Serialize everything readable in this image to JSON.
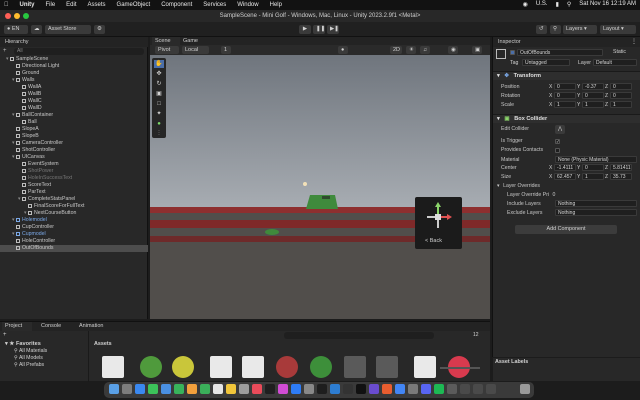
{
  "menubar": {
    "apple": "",
    "app": "Unity",
    "items": [
      "File",
      "Edit",
      "Assets",
      "GameObject",
      "Component",
      "Services",
      "Window",
      "Help"
    ],
    "right": {
      "input": "U.S.",
      "datetime": "Sat Nov 16  12:19 AM"
    }
  },
  "window": {
    "title": "SampleScene - Mini Golf - Windows, Mac, Linux - Unity 2023.2.9f1 <Metal>"
  },
  "toolbar": {
    "account": "EN",
    "asset_store": "Asset Store",
    "layers": "Layers",
    "layout": "Layout"
  },
  "hierarchy": {
    "tab": "Hierarchy",
    "search_placeholder": "All",
    "rows": [
      {
        "label": "SampleScene",
        "indent": 0,
        "kind": "scene"
      },
      {
        "label": "Directional Light",
        "indent": 1
      },
      {
        "label": "Ground",
        "indent": 1
      },
      {
        "label": "Walls",
        "indent": 1,
        "arrow": true
      },
      {
        "label": "WallA",
        "indent": 2
      },
      {
        "label": "WallB",
        "indent": 2
      },
      {
        "label": "WallC",
        "indent": 2
      },
      {
        "label": "WallD",
        "indent": 2
      },
      {
        "label": "BallContainer",
        "indent": 1,
        "arrow": true
      },
      {
        "label": "Ball",
        "indent": 2
      },
      {
        "label": "SlopeA",
        "indent": 1
      },
      {
        "label": "SlopeB",
        "indent": 1
      },
      {
        "label": "CameraController",
        "indent": 1,
        "arrow": true
      },
      {
        "label": "ShotController",
        "indent": 1
      },
      {
        "label": "UICanvas",
        "indent": 1,
        "arrow": true
      },
      {
        "label": "EventSystem",
        "indent": 2
      },
      {
        "label": "ShotPower",
        "indent": 2,
        "dim": true
      },
      {
        "label": "HoleInSuccessText",
        "indent": 2,
        "dim": true
      },
      {
        "label": "ScoreText",
        "indent": 2
      },
      {
        "label": "ParText",
        "indent": 2
      },
      {
        "label": "CompleteStatsPanel",
        "indent": 2,
        "arrow": true
      },
      {
        "label": "FinalScoreForFullText",
        "indent": 3
      },
      {
        "label": "NextCourseButton",
        "indent": 3,
        "arrow": true
      },
      {
        "label": "Holemodel",
        "indent": 1,
        "blue": true,
        "arrow": true
      },
      {
        "label": "CupController",
        "indent": 1
      },
      {
        "label": "Cupmodel",
        "indent": 1,
        "blue": true,
        "arrow": true
      },
      {
        "label": "HoleController",
        "indent": 1
      },
      {
        "label": "OutOfBounds",
        "indent": 1,
        "selected": true
      }
    ]
  },
  "scene": {
    "tabs": [
      "Scene",
      "Game"
    ],
    "pivot": "Pivot",
    "local": "Local",
    "grid_value": "1",
    "mode_2d": "2D",
    "back_label": "< Back"
  },
  "inspector": {
    "tab": "Inspector",
    "object_name": "OutOfBounds",
    "static_label": "Static",
    "tag_label": "Tag",
    "tag_value": "Untagged",
    "layer_label": "Layer",
    "layer_value": "Default",
    "transform": {
      "title": "Transform",
      "position": {
        "label": "Position",
        "x": "0",
        "y": "-0.37",
        "z": "0"
      },
      "rotation": {
        "label": "Rotation",
        "x": "0",
        "y": "0",
        "z": "0"
      },
      "scale": {
        "label": "Scale",
        "x": "1",
        "y": "1",
        "z": "1"
      }
    },
    "box_collider": {
      "title": "Box Collider",
      "edit_collider": "Edit Collider",
      "is_trigger": "Is Trigger",
      "provides_contacts": "Provides Contacts",
      "material_label": "Material",
      "material_value": "None (Physic Material)",
      "center": {
        "label": "Center",
        "x": "-1.4111",
        "y": "0",
        "z": "5.81411"
      },
      "size": {
        "label": "Size",
        "x": "62.457",
        "y": "1",
        "z": "35.73"
      }
    },
    "layer_overrides": {
      "title": "Layer Overrides",
      "priority_label": "Layer Override Pri",
      "priority_value": "0",
      "include_label": "Include Layers",
      "include_value": "Nothing",
      "exclude_label": "Exclude Layers",
      "exclude_value": "Nothing"
    },
    "add_component": "Add Component",
    "asset_labels": "Asset Labels"
  },
  "project": {
    "tabs": [
      "Project",
      "Console",
      "Animation"
    ],
    "favorites": "Favorites",
    "fav_items": [
      "All Materials",
      "All Models",
      "All Prefabs"
    ],
    "assets_label": "Assets",
    "count": "12"
  },
  "colors": {
    "sky": "#9fa6b0",
    "ground": "#4e4a47",
    "wall_red": "#8e2f2f",
    "grass": "#3f8a3c",
    "accent_blue": "#7ba9e8"
  }
}
